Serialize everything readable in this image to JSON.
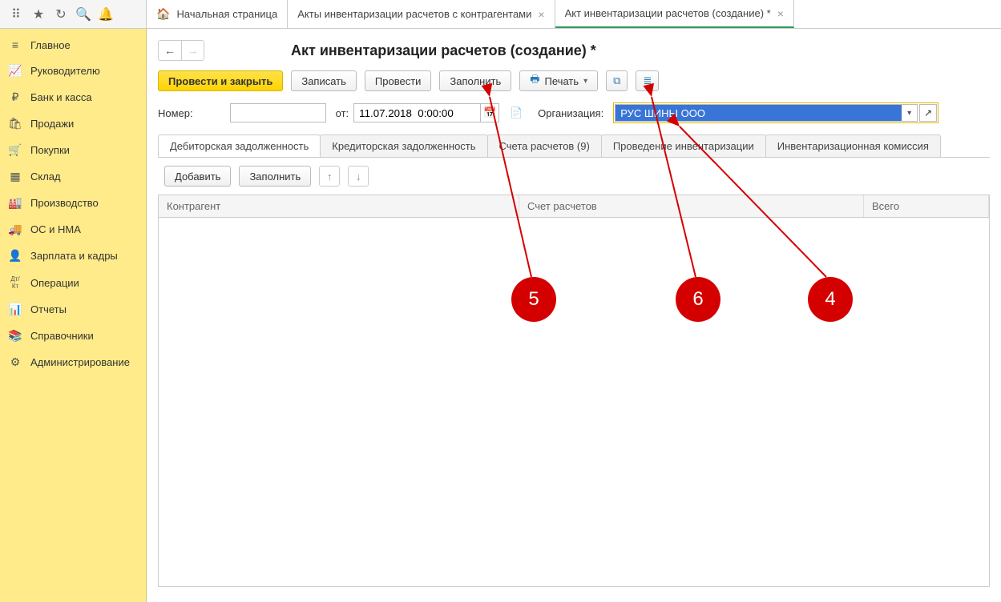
{
  "topbar": {
    "tabs": [
      {
        "label": "Начальная страница"
      },
      {
        "label": "Акты инвентаризации расчетов с контрагентами"
      },
      {
        "label": "Акт инвентаризации расчетов (создание) *"
      }
    ]
  },
  "sidebar": {
    "items": [
      {
        "label": "Главное",
        "icon": "≡"
      },
      {
        "label": "Руководителю",
        "icon": "📈"
      },
      {
        "label": "Банк и касса",
        "icon": "₽"
      },
      {
        "label": "Продажи",
        "icon": "🛍"
      },
      {
        "label": "Покупки",
        "icon": "🛒"
      },
      {
        "label": "Склад",
        "icon": "▦"
      },
      {
        "label": "Производство",
        "icon": "🏭"
      },
      {
        "label": "ОС и НМА",
        "icon": "🚚"
      },
      {
        "label": "Зарплата и кадры",
        "icon": "👤"
      },
      {
        "label": "Операции",
        "icon": "Дт/Кт"
      },
      {
        "label": "Отчеты",
        "icon": "📊"
      },
      {
        "label": "Справочники",
        "icon": "📚"
      },
      {
        "label": "Администрирование",
        "icon": "⚙"
      }
    ]
  },
  "page": {
    "title": "Акт инвентаризации расчетов (создание) *"
  },
  "toolbar": {
    "post_close": "Провести и закрыть",
    "save": "Записать",
    "post": "Провести",
    "fill": "Заполнить",
    "print": "Печать"
  },
  "form": {
    "number_label": "Номер:",
    "number_value": "",
    "from_label": "от:",
    "date_value": "11.07.2018  0:00:00",
    "org_label": "Организация:",
    "org_value": "РУС ШИНЫ ООО"
  },
  "subtabs": [
    "Дебиторская задолженность",
    "Кредиторская задолженность",
    "Счета расчетов (9)",
    "Проведение инвентаризации",
    "Инвентаризационная комиссия"
  ],
  "subtoolbar": {
    "add": "Добавить",
    "fill": "Заполнить"
  },
  "grid": {
    "columns": [
      "Контрагент",
      "Счет расчетов",
      "Всего"
    ]
  },
  "annotations": {
    "a4": "4",
    "a5": "5",
    "a6": "6"
  }
}
